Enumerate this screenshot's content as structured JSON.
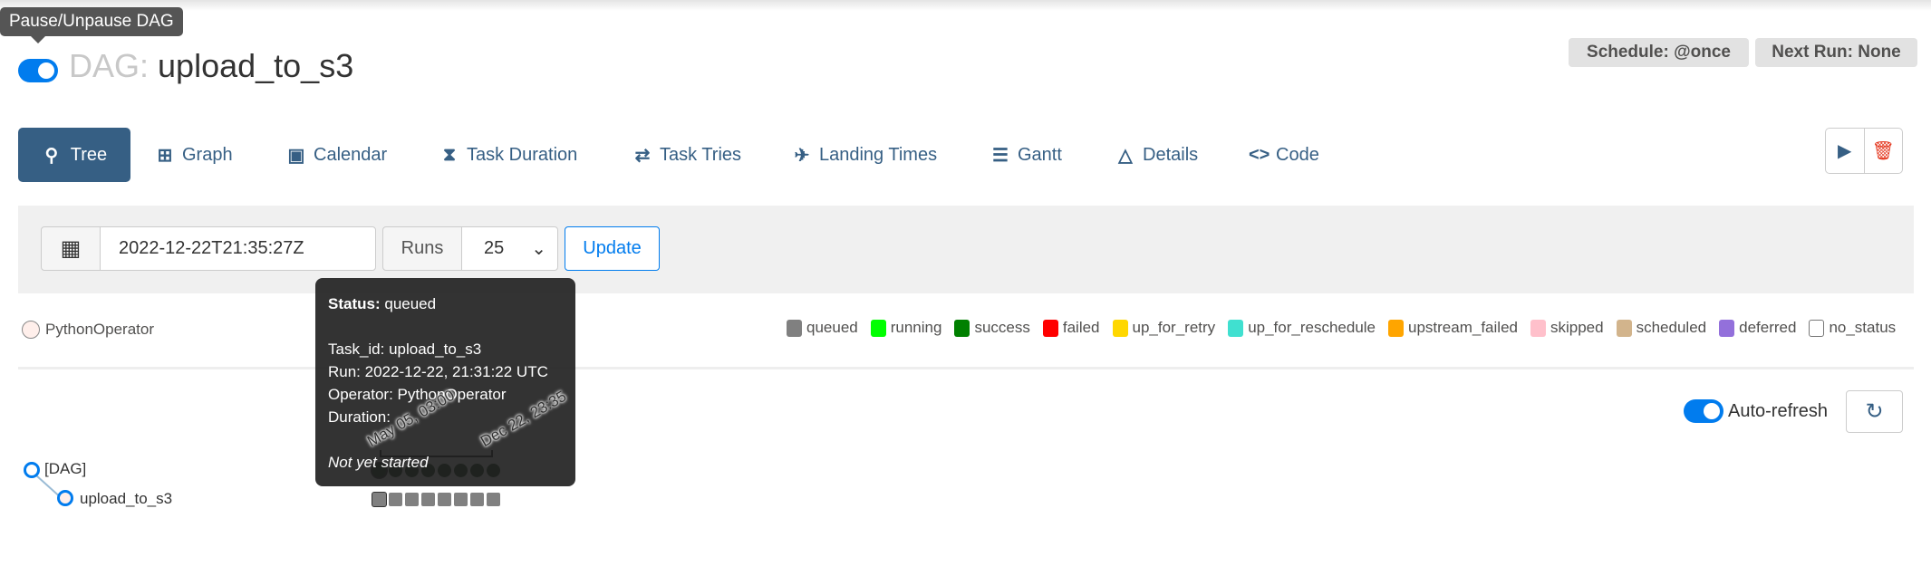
{
  "tooltip_pause": "Pause/Unpause DAG",
  "header": {
    "prefix": "DAG:",
    "dag_id": "upload_to_s3",
    "paused": false,
    "schedule": "Schedule: @once",
    "next_run": "Next Run: None"
  },
  "nav": {
    "active": "Tree",
    "items": [
      {
        "label": "Tree",
        "icon": "tree-icon"
      },
      {
        "label": "Graph",
        "icon": "graph-icon"
      },
      {
        "label": "Calendar",
        "icon": "calendar-icon"
      },
      {
        "label": "Task Duration",
        "icon": "hourglass-icon"
      },
      {
        "label": "Task Tries",
        "icon": "repeat-icon"
      },
      {
        "label": "Landing Times",
        "icon": "plane-landing-icon"
      },
      {
        "label": "Gantt",
        "icon": "gantt-icon"
      },
      {
        "label": "Details",
        "icon": "warning-triangle-icon"
      },
      {
        "label": "Code",
        "icon": "code-icon"
      }
    ]
  },
  "actions": {
    "trigger": "play-icon",
    "delete": "trash-icon"
  },
  "filter": {
    "base_date": "2022-12-22T21:35:27Z",
    "runs_label": "Runs",
    "runs_value": "25",
    "update_label": "Update"
  },
  "operator_legend": {
    "label": "PythonOperator",
    "color": "#ffefeb"
  },
  "state_legend": [
    {
      "label": "queued",
      "color": "#808080"
    },
    {
      "label": "running",
      "color": "#00ff00"
    },
    {
      "label": "success",
      "color": "#008000"
    },
    {
      "label": "failed",
      "color": "#ff0000"
    },
    {
      "label": "up_for_retry",
      "color": "#ffd700"
    },
    {
      "label": "up_for_reschedule",
      "color": "#40e0d0"
    },
    {
      "label": "upstream_failed",
      "color": "#ffa500"
    },
    {
      "label": "skipped",
      "color": "#ffc0cb"
    },
    {
      "label": "scheduled",
      "color": "#d2b48c"
    },
    {
      "label": "deferred",
      "color": "#9370db"
    },
    {
      "label": "no_status",
      "color": "#ffffff"
    }
  ],
  "auto_refresh": {
    "label": "Auto-refresh",
    "enabled": true
  },
  "tree": {
    "root": "[DAG]",
    "task": "upload_to_s3",
    "dates": [
      "May 05, 03:00",
      "Dec 22, 23:35"
    ],
    "run_count": 8
  },
  "task_tooltip": {
    "status_label": "Status:",
    "status": "queued",
    "task_id": "Task_id: upload_to_s3",
    "run": "Run: 2022-12-22, 21:31:22 UTC",
    "operator": "Operator: PythonOperator",
    "duration": "Duration:",
    "note": "Not yet started"
  }
}
